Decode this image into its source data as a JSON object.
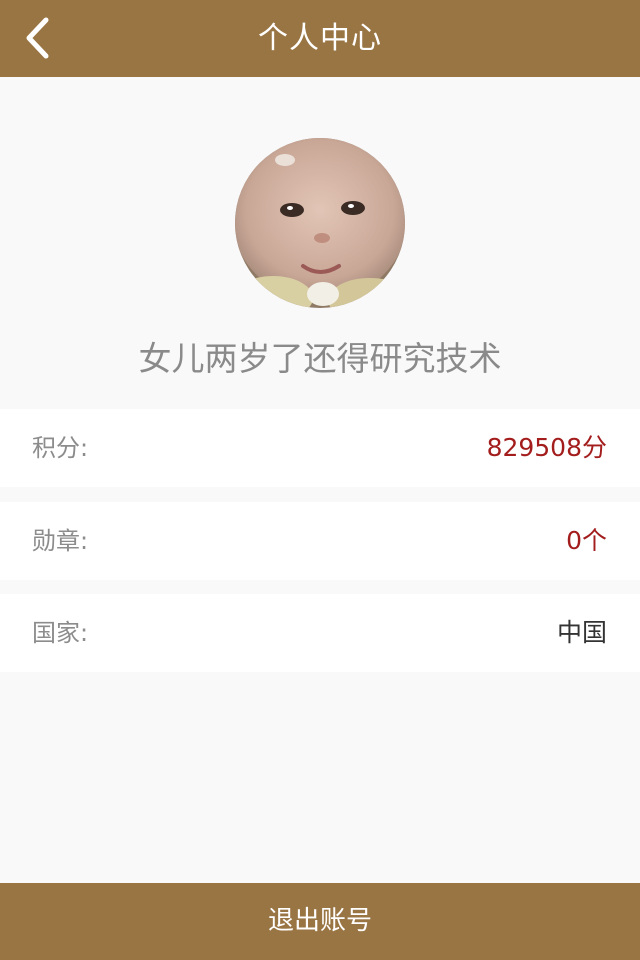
{
  "header": {
    "title": "个人中心",
    "back_icon": "chevron-left-icon"
  },
  "profile": {
    "nickname": "女儿两岁了还得研究技术"
  },
  "info_rows": [
    {
      "label": "积分:",
      "value": "829508分"
    },
    {
      "label": "勋章:",
      "value": "0个"
    },
    {
      "label": "国家:",
      "value": "中国"
    }
  ],
  "footer": {
    "logout_label": "退出账号"
  },
  "colors": {
    "brand": "#9a7544",
    "page_background": "#f9f9f9",
    "value_red": "#a31d1d",
    "value_dark": "#333333",
    "label_gray": "#8c8c8c"
  }
}
